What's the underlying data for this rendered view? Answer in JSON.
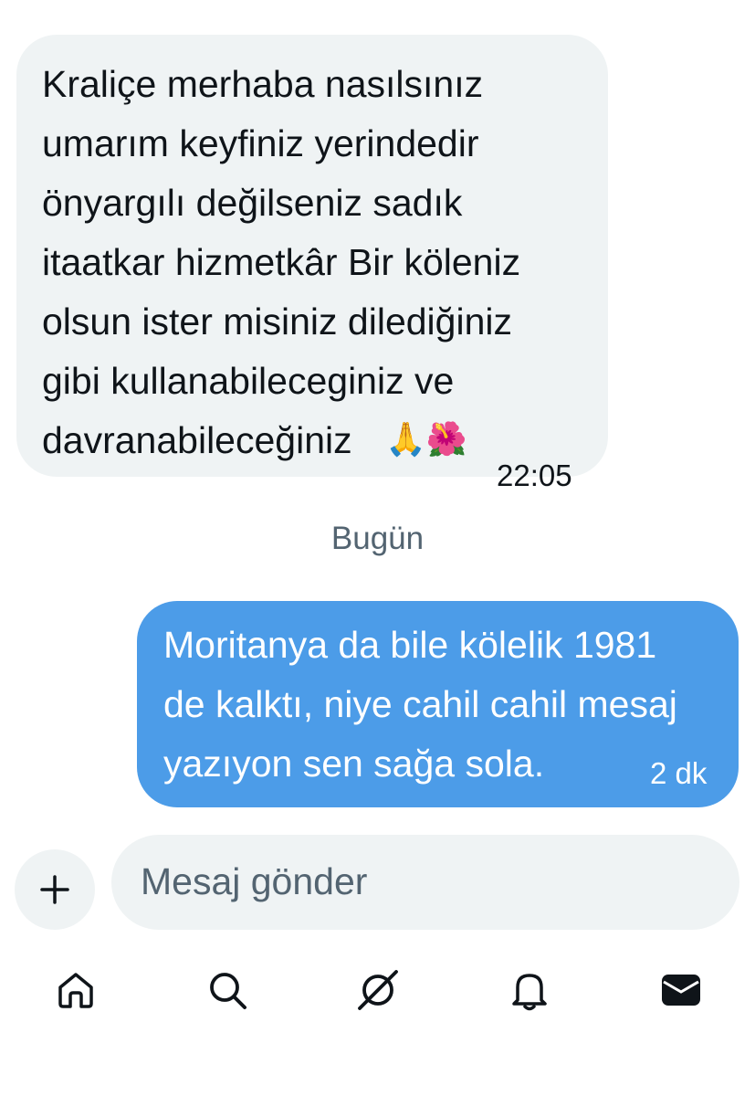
{
  "messages": [
    {
      "direction": "incoming",
      "text": "Kraliçe merhaba nasılsınız\numarım keyfiniz yerindedir\nönyargılı değilseniz  sadık\nitaatkar hizmetkâr Bir köleniz\nolsun ister misiniz dilediğiniz\ngibi kullanabileceginiz ve\ndavranabileceğiniz",
      "emoji": "🙏🌺",
      "time": "22:05"
    },
    {
      "direction": "outgoing",
      "text": "Moritanya da bile kölelik 1981\nde kalktı, niye cahil cahil mesaj\nyazıyon sen sağa sola.",
      "time": "2 dk"
    }
  ],
  "day_separator": "Bugün",
  "composer": {
    "placeholder": "Mesaj gönder",
    "add_icon": "plus-icon"
  },
  "bottom_nav": {
    "icons": [
      "home-icon",
      "search-icon",
      "grok-icon",
      "bell-icon",
      "mail-icon"
    ]
  },
  "colors": {
    "incoming_bubble": "#eff3f4",
    "outgoing_bubble": "#4c9ce8",
    "muted_text": "#536471",
    "text": "#0f1419"
  }
}
